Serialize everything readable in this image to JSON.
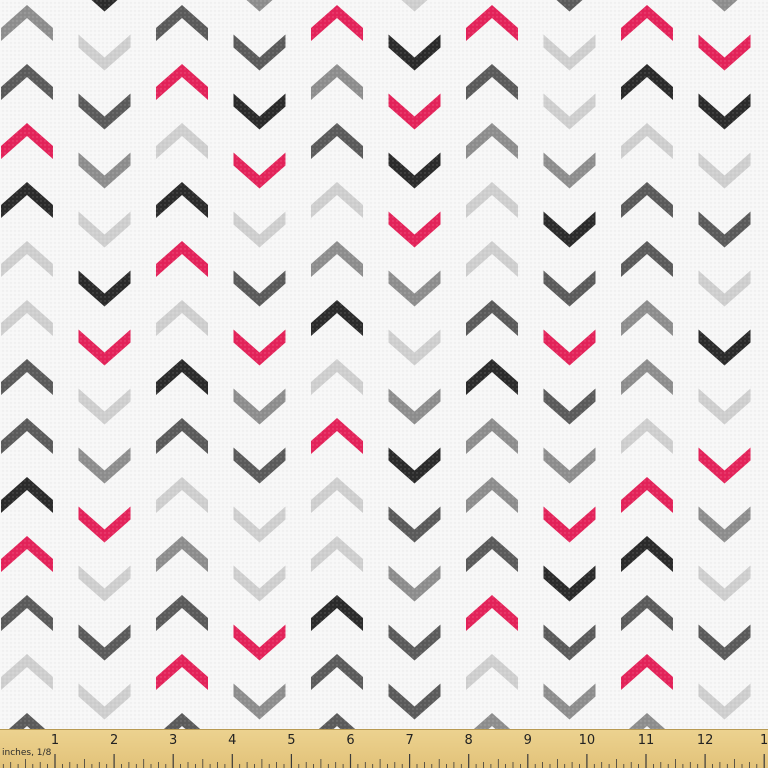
{
  "fabric": {
    "background": "#f7f7f7",
    "colors": {
      "pink": "#e4235a",
      "black": "#2b2b2b",
      "dark": "#5b5b5b",
      "mid": "#8e8e8e",
      "light": "#cfcfcf"
    },
    "columns": [
      [
        "mid",
        "dark",
        "pink",
        "black",
        "light",
        "light",
        "dark",
        "dark",
        "black",
        "pink",
        "dark",
        "light",
        "dark"
      ],
      [
        "black",
        "light",
        "dark",
        "mid",
        "light",
        "black",
        "pink",
        "light",
        "mid",
        "pink",
        "light",
        "dark",
        "light"
      ],
      [
        "dark",
        "pink",
        "light",
        "black",
        "pink",
        "light",
        "black",
        "dark",
        "light",
        "mid",
        "dark",
        "pink",
        "dark"
      ],
      [
        "mid",
        "dark",
        "black",
        "pink",
        "light",
        "dark",
        "pink",
        "mid",
        "dark",
        "light",
        "light",
        "pink",
        "mid"
      ],
      [
        "pink",
        "mid",
        "dark",
        "light",
        "mid",
        "black",
        "light",
        "pink",
        "light",
        "light",
        "black",
        "dark",
        "dark"
      ],
      [
        "light",
        "black",
        "pink",
        "black",
        "pink",
        "mid",
        "light",
        "mid",
        "black",
        "dark",
        "mid",
        "dark",
        "dark"
      ],
      [
        "pink",
        "dark",
        "mid",
        "light",
        "light",
        "dark",
        "black",
        "mid",
        "mid",
        "dark",
        "pink",
        "light",
        "mid"
      ],
      [
        "dark",
        "light",
        "light",
        "mid",
        "black",
        "dark",
        "pink",
        "dark",
        "mid",
        "pink",
        "black",
        "dark",
        "mid"
      ],
      [
        "pink",
        "black",
        "light",
        "dark",
        "dark",
        "mid",
        "mid",
        "light",
        "pink",
        "black",
        "dark",
        "pink",
        "mid"
      ],
      [
        "mid",
        "pink",
        "black",
        "light",
        "dark",
        "light",
        "black",
        "light",
        "pink",
        "mid",
        "light",
        "dark",
        "light"
      ],
      [
        "dark",
        "mid",
        "light",
        "dark",
        "black",
        "dark",
        "light",
        "pink",
        "pink",
        "dark",
        "light",
        "dark",
        "mid"
      ],
      [
        "light",
        "pink",
        "dark",
        "black",
        "pink",
        "light",
        "mid",
        "dark",
        "pink",
        "dark",
        "dark",
        "light",
        "black"
      ],
      [
        "mid",
        "dark",
        "black",
        "pink",
        "dark",
        "light",
        "dark",
        "black",
        "light",
        "pink",
        "light",
        "dark",
        "mid"
      ]
    ]
  },
  "ruler": {
    "unit_label": "inches, 1/8",
    "numbers": [
      "1",
      "2",
      "3",
      "4",
      "5",
      "6",
      "7",
      "8",
      "9",
      "10",
      "11",
      "12",
      "1"
    ]
  }
}
